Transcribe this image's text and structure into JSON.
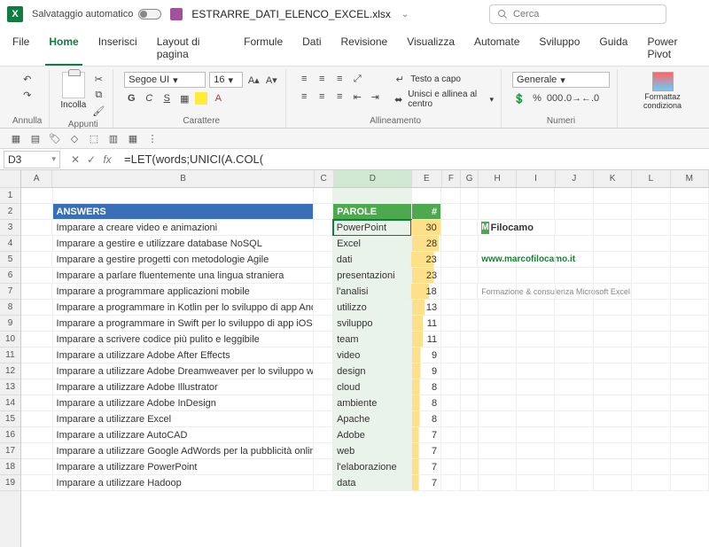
{
  "titlebar": {
    "autosave_label": "Salvataggio automatico",
    "filename": "ESTRARRE_DATI_ELENCO_EXCEL.xlsx",
    "search_placeholder": "Cerca"
  },
  "menu": {
    "tabs": [
      "File",
      "Home",
      "Inserisci",
      "Layout di pagina",
      "Formule",
      "Dati",
      "Revisione",
      "Visualizza",
      "Automate",
      "Sviluppo",
      "Guida",
      "Power Pivot"
    ],
    "active": "Home"
  },
  "ribbon": {
    "undo": "Annulla",
    "clipboard": {
      "paste": "Incolla",
      "label": "Appunti"
    },
    "font": {
      "name": "Segoe UI",
      "size": "16",
      "label": "Carattere"
    },
    "align": {
      "wrap": "Testo a capo",
      "merge": "Unisci e allinea al centro",
      "label": "Allineamento"
    },
    "number": {
      "format": "Generale",
      "label": "Numeri"
    },
    "styles": {
      "cond": "Formattaz condiziona"
    }
  },
  "formula_bar": {
    "cellref": "D3",
    "formula": "=LET(words;UNICI(A.COL("
  },
  "columns": [
    "A",
    "B",
    "C",
    "D",
    "E",
    "F",
    "G",
    "H",
    "I",
    "J",
    "K",
    "L",
    "M"
  ],
  "headers": {
    "answers": "ANSWERS",
    "parole": "PAROLE",
    "count": "#"
  },
  "sidebar": {
    "brand": "Filocamo",
    "url": "www.marcofilocamo.it",
    "tagline": "Formazione & consulenza Microsoft Excel"
  },
  "chart_data": {
    "type": "table",
    "title": "PAROLE #",
    "max": 30,
    "rows": [
      {
        "answer": "Imparare a creare video e animazioni",
        "word": "PowerPoint",
        "count": 30
      },
      {
        "answer": "Imparare a gestire e utilizzare database NoSQL",
        "word": "Excel",
        "count": 28
      },
      {
        "answer": "Imparare a gestire progetti con metodologie Agile",
        "word": "dati",
        "count": 23
      },
      {
        "answer": "Imparare a parlare fluentemente una lingua straniera",
        "word": "presentazioni",
        "count": 23
      },
      {
        "answer": "Imparare a programmare applicazioni mobile",
        "word": "l'analisi",
        "count": 18
      },
      {
        "answer": "Imparare a programmare in Kotlin per lo sviluppo di app Android",
        "word": "utilizzo",
        "count": 13
      },
      {
        "answer": "Imparare a programmare in Swift per lo sviluppo di app iOS",
        "word": "sviluppo",
        "count": 11
      },
      {
        "answer": "Imparare a scrivere codice più pulito e leggibile",
        "word": "team",
        "count": 11
      },
      {
        "answer": "Imparare a utilizzare Adobe After Effects",
        "word": "video",
        "count": 9
      },
      {
        "answer": "Imparare a utilizzare Adobe Dreamweaver per lo sviluppo web",
        "word": "design",
        "count": 9
      },
      {
        "answer": "Imparare a utilizzare Adobe Illustrator",
        "word": "cloud",
        "count": 8
      },
      {
        "answer": "Imparare a utilizzare Adobe InDesign",
        "word": "ambiente",
        "count": 8
      },
      {
        "answer": "Imparare a utilizzare Excel",
        "word": "Apache",
        "count": 8
      },
      {
        "answer": "Imparare a utilizzare AutoCAD",
        "word": "Adobe",
        "count": 7
      },
      {
        "answer": "Imparare a utilizzare Google AdWords per la pubblicità online",
        "word": "web",
        "count": 7
      },
      {
        "answer": "Imparare a utilizzare PowerPoint",
        "word": "l'elaborazione",
        "count": 7
      },
      {
        "answer": "Imparare a utilizzare Hadoop",
        "word": "data",
        "count": 7
      }
    ]
  }
}
